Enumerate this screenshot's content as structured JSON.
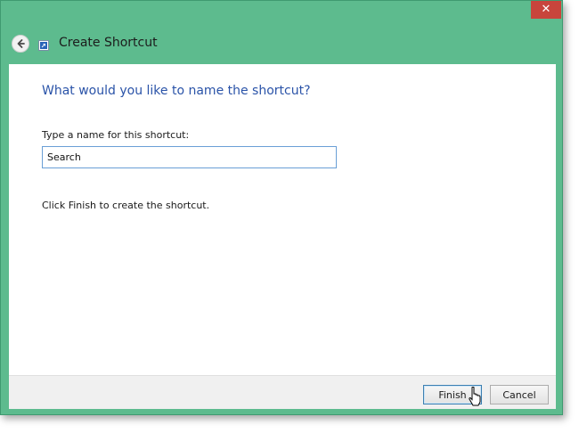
{
  "window": {
    "title": "Create Shortcut",
    "close_label": "✕",
    "accent_color": "#5dbb8e",
    "close_color": "#c8453c"
  },
  "wizard": {
    "heading": "What would you like to name the shortcut?",
    "name_label": "Type a name for this shortcut:",
    "name_value": "Search",
    "hint": "Click Finish to create the shortcut."
  },
  "footer": {
    "finish_label": "Finish",
    "cancel_label": "Cancel"
  },
  "icons": {
    "back": "back-arrow-icon",
    "shortcut": "shortcut-icon",
    "cursor": "mouse-cursor-icon"
  }
}
